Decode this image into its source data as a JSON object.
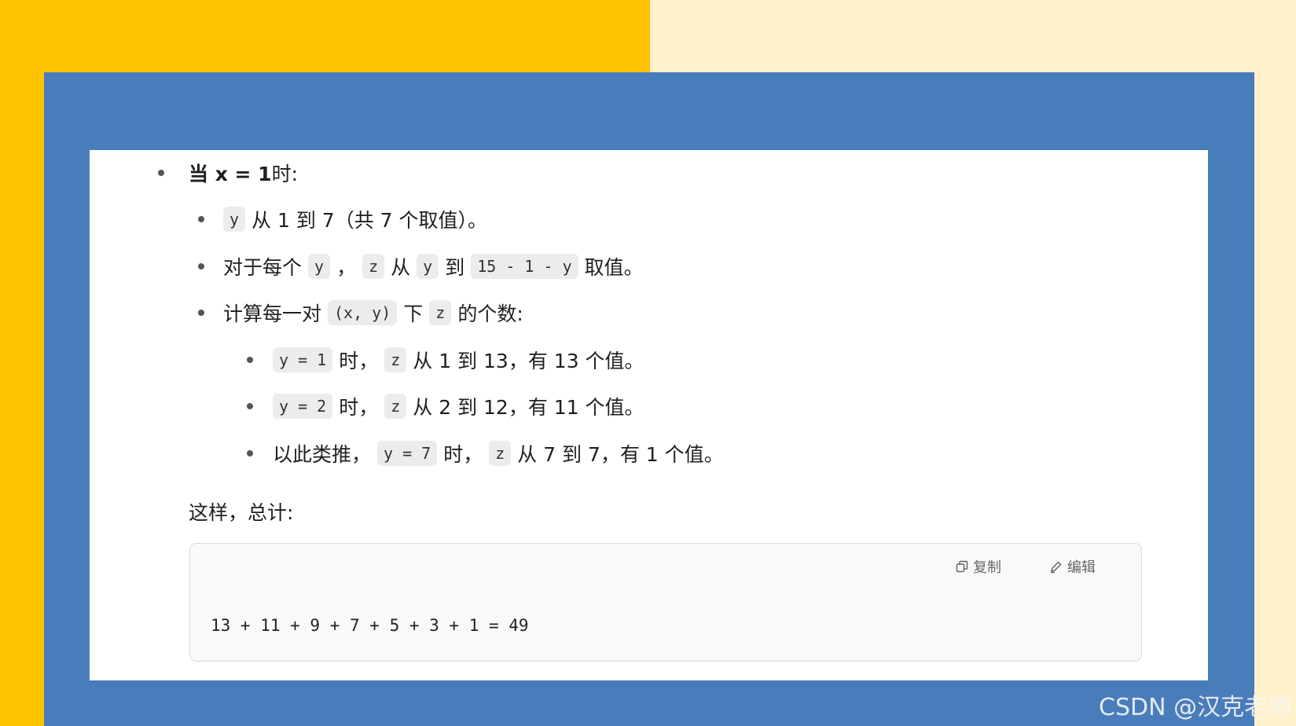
{
  "colors": {
    "left_bg": "#FFC200",
    "right_bg": "#FFF1CC",
    "frame": "#497CBB",
    "content_bg": "#FFFFFF",
    "code_bg": "#ECECEC"
  },
  "lines": {
    "l1": {
      "bold": "当 x = 1",
      "text": " 时:"
    },
    "l2": {
      "code1": "y",
      "text": "从 1 到 7（共 7 个取值）。"
    },
    "l3": {
      "t1": "对于每个",
      "code1": "y",
      "t2": "，",
      "code2": "z",
      "t3": "从",
      "code3": "y",
      "t4": "到",
      "code4": "15 - 1 - y",
      "t5": "取值。"
    },
    "l4": {
      "t1": "计算每一对",
      "code1": "(x, y)",
      "t2": "下",
      "code2": "z",
      "t3": "的个数:"
    },
    "l5": {
      "code1": "y = 1",
      "t1": "时，",
      "code2": "z",
      "t2": "从 1 到 13，有 13 个值。"
    },
    "l6": {
      "code1": "y = 2",
      "t1": "时，",
      "code2": "z",
      "t2": "从 2 到 12，有 11 个值。"
    },
    "l7": {
      "t1": "以此类推，",
      "code1": "y = 7",
      "t2": "时，",
      "code2": "z",
      "t3": "从 7 到 7，有 1 个值。"
    },
    "summary": "这样，总计:"
  },
  "codeblock": {
    "copy_label": "复制",
    "edit_label": "编辑",
    "code": "13 + 11 + 9 + 7 + 5 + 3 + 1 = 49"
  },
  "watermark": "CSDN @汉克老师"
}
